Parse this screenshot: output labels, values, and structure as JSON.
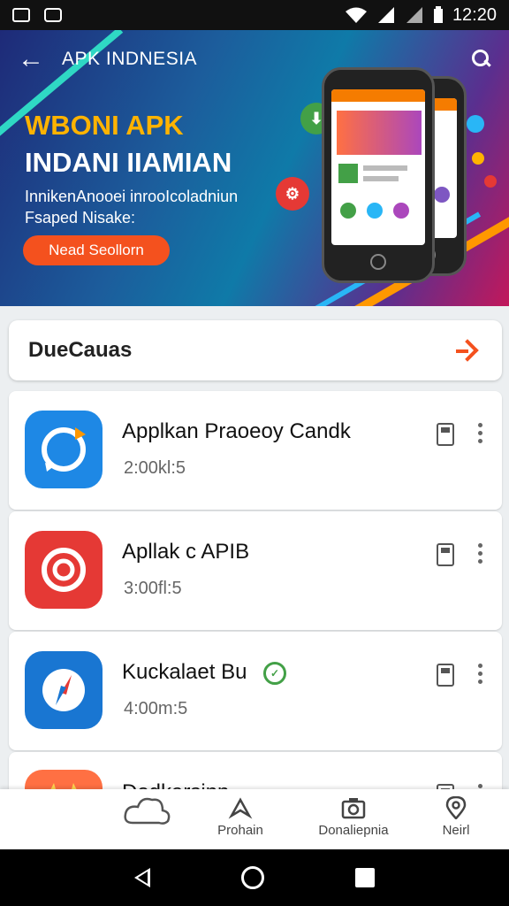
{
  "status_bar": {
    "time": "12:20"
  },
  "app_bar": {
    "title": "APK INDNESIA"
  },
  "hero": {
    "headline1": "WBONI APK",
    "headline2": "INDANI IIAMIAN",
    "subtitle1": "InnikenAnooei inrooIcoladniun",
    "subtitle2": "Fsaped Nisake:",
    "cta_label": "Nead Seollorn"
  },
  "section": {
    "title": "DueCauas"
  },
  "apps": [
    {
      "name": "Applkan Praoeoy Candk",
      "size": "2:00kl:5",
      "icon": "sync-icon",
      "color": "#1e88e5"
    },
    {
      "name": "Apllak c APIB",
      "size": "3:00fl:5",
      "icon": "target-icon",
      "color": "#e53935"
    },
    {
      "name": "Kuckalaet Bu",
      "size": "4:00m:5",
      "icon": "compass-icon",
      "color": "#1976d2"
    },
    {
      "name": "Dodkarsinn",
      "size": "",
      "icon": "mascot-icon",
      "color": "#ff7043"
    }
  ],
  "bottom_nav": [
    {
      "label": "",
      "icon": "cloud-icon"
    },
    {
      "label": "Prohain",
      "icon": "send-icon"
    },
    {
      "label": "Donaliepnia",
      "icon": "camera-icon"
    },
    {
      "label": "Neirl",
      "icon": "location-icon"
    }
  ],
  "colors": {
    "accent": "#f4511e",
    "hero_gold": "#ffb300"
  }
}
